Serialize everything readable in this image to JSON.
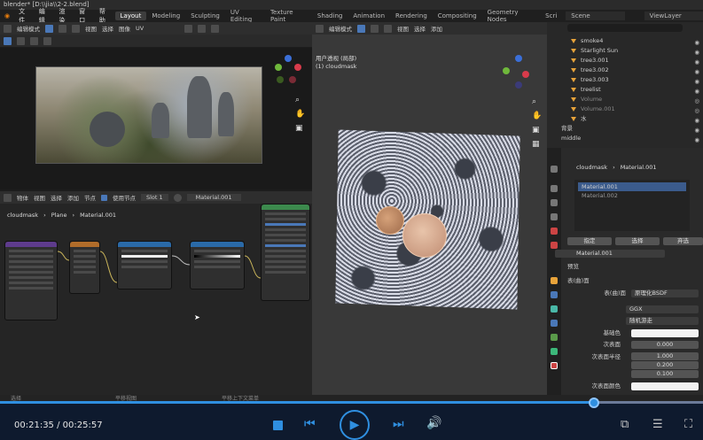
{
  "window": {
    "title": "blender* [D:\\\\jia\\\\2-2.blend]"
  },
  "menu": [
    "文件",
    "编辑",
    "渲染",
    "窗口",
    "帮助"
  ],
  "workspaces": [
    "Layout",
    "Modeling",
    "Sculpting",
    "UV Editing",
    "Texture Paint",
    "Shading",
    "Animation",
    "Rendering",
    "Compositing",
    "Geometry Nodes",
    "Scri"
  ],
  "active_workspace": "Layout",
  "scene": {
    "label": "Scene",
    "view_layer": "ViewLayer"
  },
  "image_editor": {
    "mode": "编辑模式",
    "menus": [
      "视图",
      "选择",
      "图像",
      "UV"
    ]
  },
  "viewport": {
    "mode": "编辑模式",
    "menus": [
      "视图",
      "选择",
      "添加"
    ],
    "overlay_title": "用户透视 (局部)",
    "overlay_object": "(1) cloudmask"
  },
  "node_editor": {
    "type": "物体",
    "menus": [
      "视图",
      "选择",
      "添加",
      "节点"
    ],
    "use_nodes_label": "使用节点",
    "slot": "Slot 1",
    "material": "Material.001",
    "breadcrumb": [
      "cloudmask",
      "Plane",
      "Material.001"
    ]
  },
  "outliner": {
    "items": [
      {
        "name": "smoke4"
      },
      {
        "name": "Starlight Sun"
      },
      {
        "name": "tree3.001"
      },
      {
        "name": "tree3.002"
      },
      {
        "name": "tree3.003"
      },
      {
        "name": "treelist"
      },
      {
        "name": "Volume"
      },
      {
        "name": "Volume.001"
      },
      {
        "name": "水"
      },
      {
        "name": "背景"
      },
      {
        "name": "middle"
      }
    ]
  },
  "properties": {
    "breadcrumb": [
      "cloudmask",
      "Material.001"
    ],
    "material_slots": [
      "Material.001",
      "Material.002"
    ],
    "mode_buttons": [
      "指定",
      "选择",
      "弃选"
    ],
    "material_name": "Material.001",
    "sections": [
      "预览",
      "表(曲)面"
    ],
    "surface_label": "表(曲)面",
    "surface_value": "原理化BSDF",
    "dist1": "GGX",
    "dist2": "随机游走",
    "fields": [
      {
        "label": "基础色",
        "value": ""
      },
      {
        "label": "次表面",
        "value": "0.000"
      },
      {
        "label": "次表面半径",
        "value": "1.000"
      },
      {
        "label": "",
        "value": "0.200"
      },
      {
        "label": "",
        "value": "0.100"
      },
      {
        "label": "次表面颜色",
        "value": ""
      }
    ]
  },
  "statusbar": {
    "left": "选择",
    "mid": "平移视图",
    "right": "平移上下文菜单"
  },
  "player": {
    "time": "00:21:35 / 00:25:57",
    "progress": 0.845
  },
  "colors": {
    "accent": "#2f8fe0",
    "player_bg": "#0e1a2e"
  }
}
